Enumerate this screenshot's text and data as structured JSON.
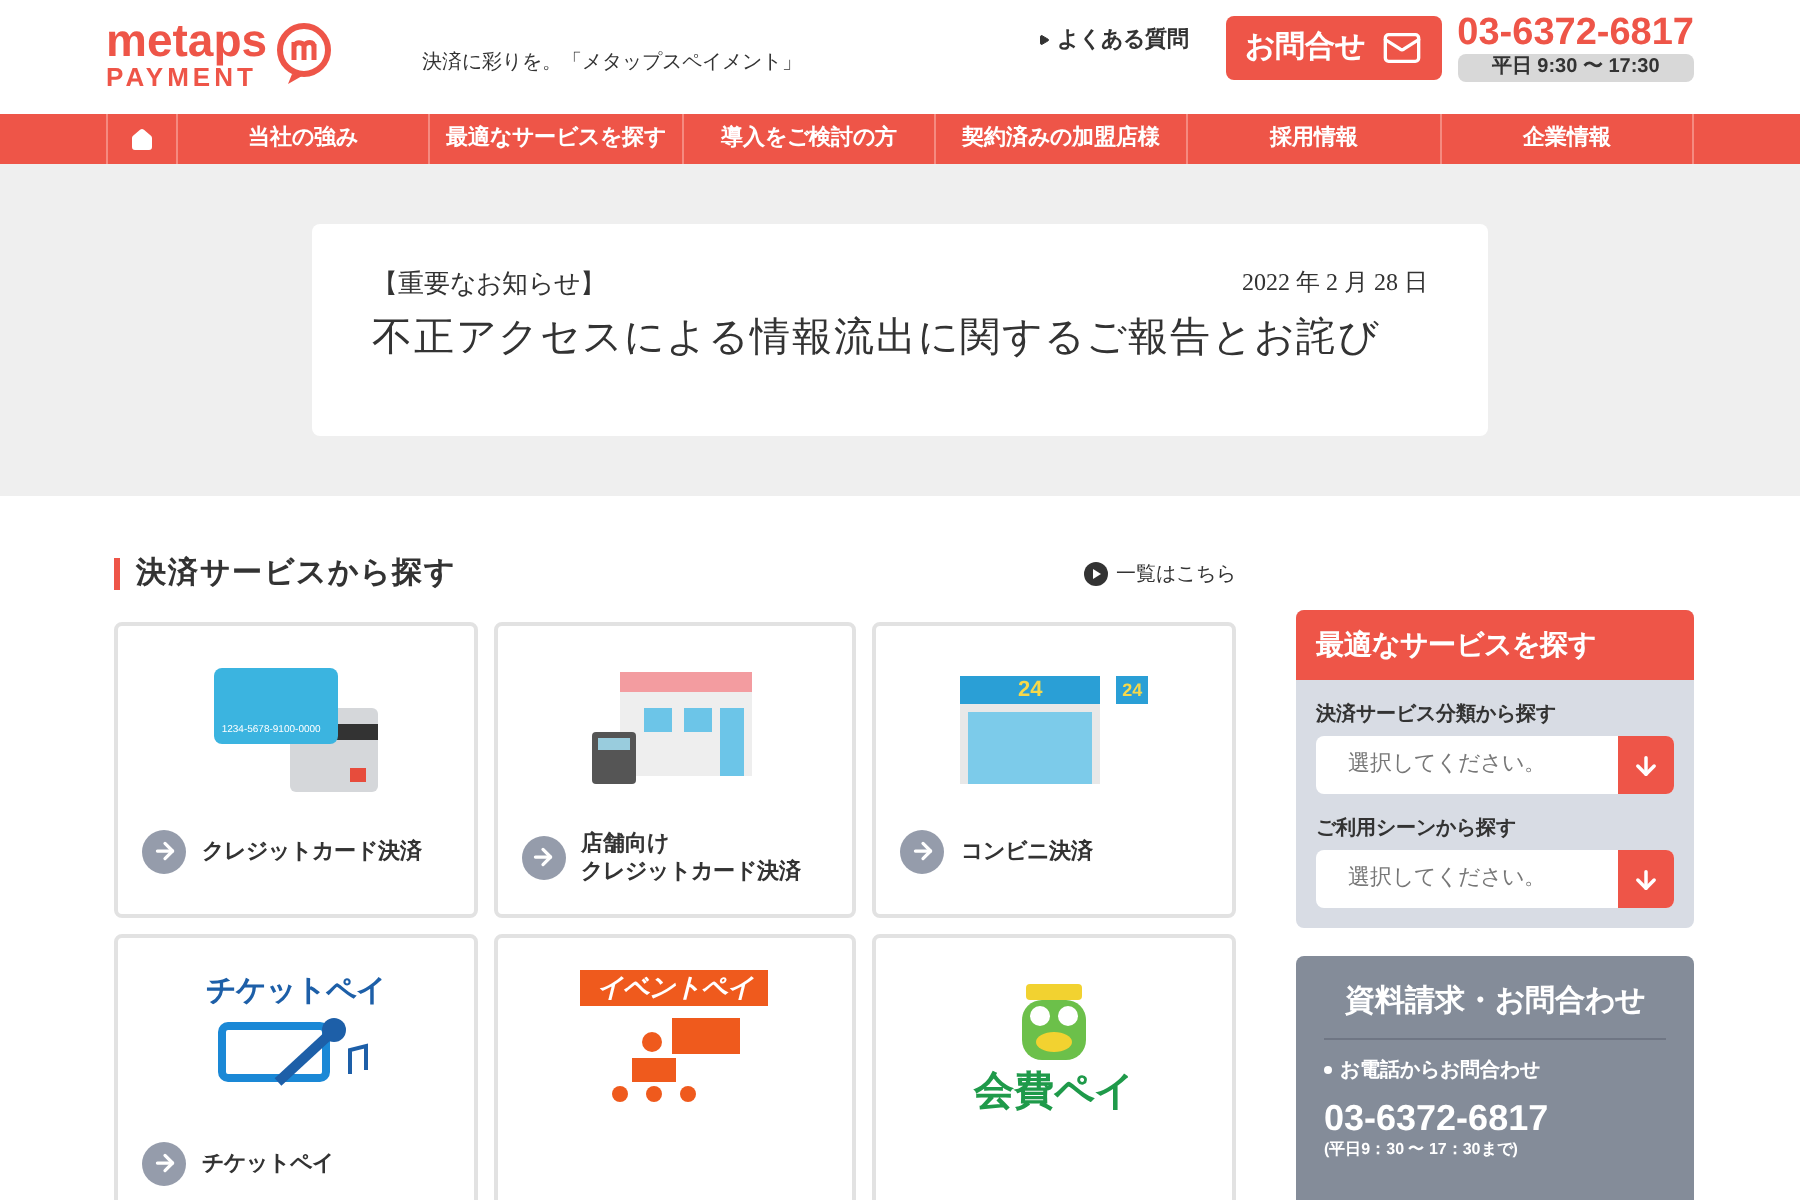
{
  "header": {
    "logo_top": "metaps",
    "logo_bottom": "PAYMENT",
    "tagline": "決済に彩りを。「メタップスペイメント」",
    "faq_link": "よくある質問",
    "contact_button": "お問合せ",
    "phone": "03-6372-6817",
    "hours": "平日 9:30 〜 17:30"
  },
  "nav": [
    {
      "label": "当社の強み"
    },
    {
      "label": "最適なサービスを探す"
    },
    {
      "label": "導入をご検討の方"
    },
    {
      "label": "契約済みの加盟店様"
    },
    {
      "label": "採用情報"
    },
    {
      "label": "企業情報"
    }
  ],
  "notice": {
    "tag": "【重要なお知らせ】",
    "date": "2022 年 2 月 28 日",
    "title": "不正アクセスによる情報流出に関するご報告とお詫び"
  },
  "services": {
    "heading": "決済サービスから探す",
    "list_link": "一覧はこちら",
    "cards": [
      {
        "kind": "card",
        "lines": [
          "クレジットカード決済"
        ],
        "card_number": "1234-5678-9100-0000"
      },
      {
        "kind": "store",
        "lines": [
          "店舗向け",
          "クレジットカード決済"
        ]
      },
      {
        "kind": "convenience",
        "lines": [
          "コンビニ決済"
        ],
        "sign": "24",
        "pole_sign": "24"
      },
      {
        "kind": "ticket",
        "logo": "チケットペイ",
        "lines": [
          "チケットペイ"
        ]
      },
      {
        "kind": "event",
        "logo": "イベントペイ"
      },
      {
        "kind": "fee",
        "logo": "会費ペイ"
      }
    ]
  },
  "finder": {
    "title": "最適なサービスを探す",
    "groups": [
      {
        "label": "決済サービス分類から探す",
        "placeholder": "選択してください。"
      },
      {
        "label": "ご利用シーンから探す",
        "placeholder": "選択してください。"
      }
    ]
  },
  "contact": {
    "title": "資料請求・お問合わせ",
    "item": "お電話からお問合わせ",
    "phone": "03-6372-6817",
    "hours": "(平日9：30 〜 17：30まで)"
  }
}
